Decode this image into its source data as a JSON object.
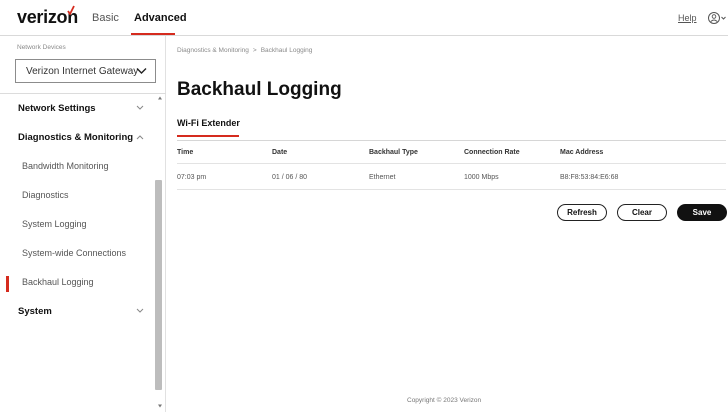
{
  "header": {
    "brand": "verizon",
    "tabs": [
      {
        "label": "Basic"
      },
      {
        "label": "Advanced"
      }
    ],
    "help_label": "Help"
  },
  "sidebar": {
    "device_label": "Network Devices",
    "device_selected": "Verizon Internet Gateway",
    "items": [
      {
        "label": "Network Settings"
      },
      {
        "label": "Diagnostics & Monitoring"
      },
      {
        "label": "Bandwidth Monitoring"
      },
      {
        "label": "Diagnostics"
      },
      {
        "label": "System Logging"
      },
      {
        "label": "System-wide Connections"
      },
      {
        "label": "Backhaul Logging"
      },
      {
        "label": "System"
      }
    ]
  },
  "main": {
    "breadcrumb": {
      "parent": "Diagnostics & Monitoring",
      "sep": ">",
      "current": "Backhaul Logging"
    },
    "title": "Backhaul Logging",
    "tab": "Wi-Fi Extender",
    "table": {
      "headers": [
        "Time",
        "Date",
        "Backhaul Type",
        "Connection Rate",
        "Mac Address"
      ],
      "rows": [
        [
          "07:03 pm",
          "01 / 06 / 80",
          "Ethernet",
          "1000 Mbps",
          "B8:F8:53:84:E6:68"
        ]
      ]
    },
    "buttons": {
      "refresh": "Refresh",
      "clear": "Clear",
      "save": "Save"
    }
  },
  "footer": {
    "copyright": "Copyright © 2023 Verizon"
  },
  "colors": {
    "accent": "#d52b1e",
    "primary": "#111111",
    "divider": "#e3e3e3"
  },
  "icons": {
    "logo_mark": "check-mark-icon",
    "user": "user-icon",
    "dropdown": "chevron-down-icon"
  }
}
